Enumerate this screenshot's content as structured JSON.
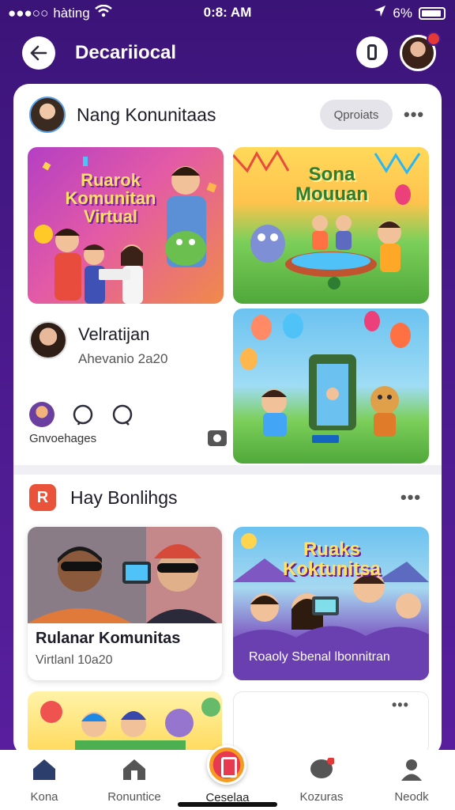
{
  "status_bar": {
    "carrier": "hàting",
    "time": "0:8: AM",
    "battery": "6%"
  },
  "header": {
    "title": "Decariiocal"
  },
  "section1": {
    "title": "Nang Konunitaas",
    "search_label": "Qproiats",
    "tiles": [
      {
        "banner": "Ruarok\nKomunitan\nVirtual"
      },
      {
        "banner": "Sona\nMouuan"
      },
      {
        "banner": ""
      }
    ],
    "mid_panel": {
      "title": "Velratijan",
      "subtitle": "Ahevanio 2a20",
      "label": "Gnvoehages"
    }
  },
  "section2": {
    "icon_letter": "R",
    "title": "Hay Bonlihgs",
    "cards": [
      {
        "caption": "Rulanar Komunitas",
        "sub": "Virtlanl 10a20"
      },
      {
        "banner": "Ruaks\nKoktunitsa",
        "caption": "Roaoly Sbenal lbonnitran"
      }
    ]
  },
  "bottom_nav": {
    "items": [
      {
        "label": "Kona"
      },
      {
        "label": "Ronuntice"
      },
      {
        "label": "Ceselaa"
      },
      {
        "label": "Kozuras"
      },
      {
        "label": "Neodk"
      }
    ]
  },
  "colors": {
    "background": "#4a1a8c",
    "accent_red": "#e53935",
    "card_bg": "#ffffff"
  }
}
